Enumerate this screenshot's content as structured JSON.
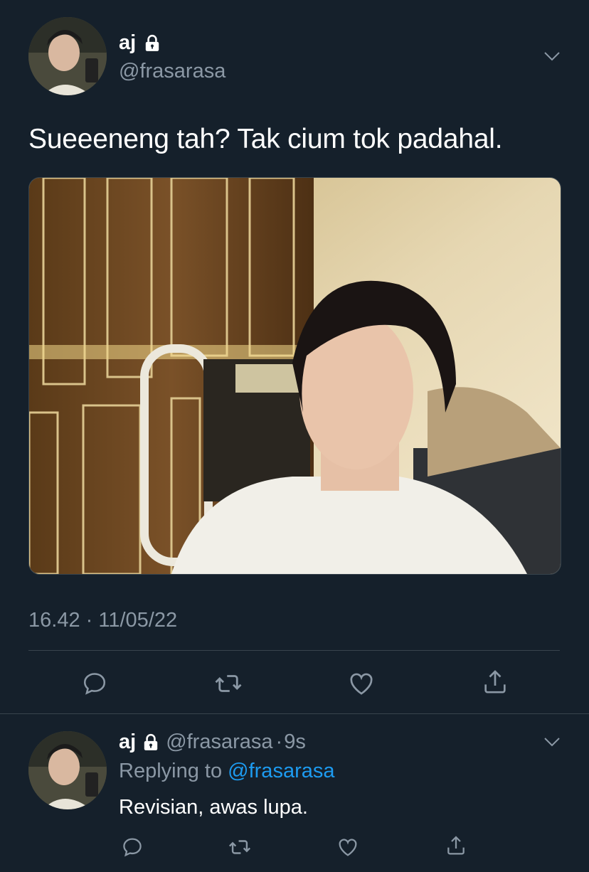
{
  "tweet": {
    "display_name": "aj",
    "handle": "@frasarasa",
    "text": "Sueeeneng tah? Tak cium tok padahal.",
    "timestamp": "16.42 · 11/05/22",
    "media_alt": "photo"
  },
  "reply": {
    "display_name": "aj",
    "handle": "@frasarasa",
    "separator": "·",
    "age": "9s",
    "replying_prefix": "Replying to",
    "replying_to": "@frasarasa",
    "text": "Revisian, awas lupa."
  },
  "icons": {
    "lock": "lock-icon",
    "chevron": "chevron-down-icon",
    "reply": "reply-icon",
    "retweet": "retweet-icon",
    "like": "like-icon",
    "share": "share-icon"
  },
  "colors": {
    "background": "#15202b",
    "secondary_text": "#8b98a5",
    "link": "#1d9bf0",
    "divider": "#38444d"
  }
}
